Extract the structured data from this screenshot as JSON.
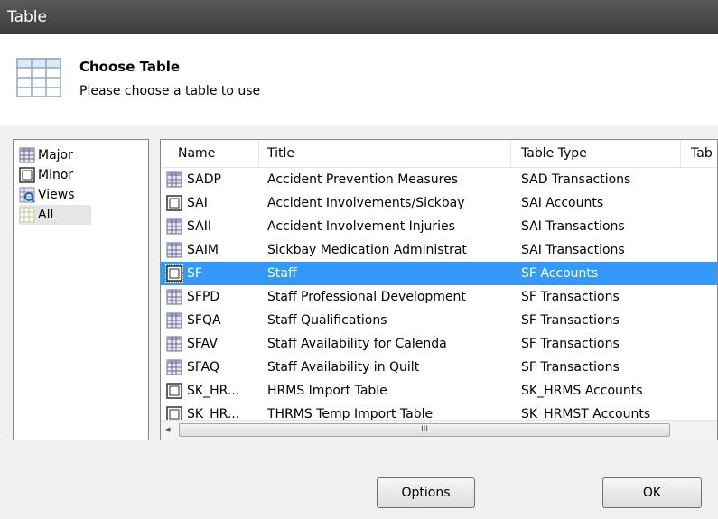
{
  "window": {
    "title": "Table"
  },
  "header": {
    "title": "Choose Table",
    "subtitle": "Please choose a table to use"
  },
  "categories": [
    {
      "label": "Major",
      "icon": "grid-icon"
    },
    {
      "label": "Minor",
      "icon": "frame-icon"
    },
    {
      "label": "Views",
      "icon": "view-icon"
    },
    {
      "label": "All",
      "icon": "light-grid-icon",
      "selected": true
    }
  ],
  "columns": [
    "Name",
    "Title",
    "Table Type",
    "Tab"
  ],
  "rows": [
    {
      "name": "SADP",
      "title": "Accident Prevention Measures",
      "type": "SAD Transactions",
      "icon": "grid-icon"
    },
    {
      "name": "SAI",
      "title": "Accident Involvements/Sickbay",
      "type": "SAI Accounts",
      "icon": "frame-icon"
    },
    {
      "name": "SAII",
      "title": "Accident Involvement Injuries",
      "type": "SAI Transactions",
      "icon": "grid-icon"
    },
    {
      "name": "SAIM",
      "title": "Sickbay Medication Administrat",
      "type": "SAI Transactions",
      "icon": "grid-icon"
    },
    {
      "name": "SF",
      "title": "Staff",
      "type": "SF Accounts",
      "icon": "frame-icon",
      "selected": true
    },
    {
      "name": "SFPD",
      "title": "Staff Professional Development",
      "type": "SF Transactions",
      "icon": "grid-icon"
    },
    {
      "name": "SFQA",
      "title": "Staff Qualifications",
      "type": "SF Transactions",
      "icon": "grid-icon"
    },
    {
      "name": "SFAV",
      "title": "Staff Availability for Calenda",
      "type": "SF Transactions",
      "icon": "grid-icon"
    },
    {
      "name": "SFAQ",
      "title": "Staff Availability in Quilt",
      "type": "SF Transactions",
      "icon": "grid-icon"
    },
    {
      "name": "SK_HR...",
      "title": "HRMS Import Table",
      "type": "SK_HRMS Accounts",
      "icon": "frame-icon"
    },
    {
      "name": "SK_HR...",
      "title": "THRMS Temp Import Table",
      "type": "SK_HRMST Accounts",
      "icon": "frame-icon"
    }
  ],
  "scrollbar": {
    "left_arrow": "◂",
    "grip": "III"
  },
  "buttons": {
    "options": "Options",
    "ok": "OK"
  }
}
